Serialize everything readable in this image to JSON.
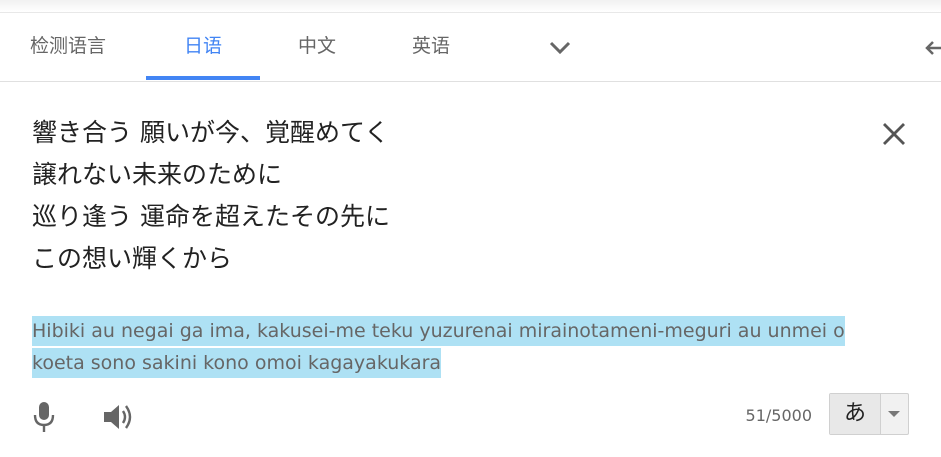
{
  "tabs": [
    {
      "label": "检测语言",
      "active": false
    },
    {
      "label": "日语",
      "active": true
    },
    {
      "label": "中文",
      "active": false
    },
    {
      "label": "英语",
      "active": false
    }
  ],
  "accent_color": "#4285f4",
  "source": {
    "lines": [
      "響き合う 願いが今、覚醒めてく",
      "譲れない未来のために",
      "巡り逢う 運命を超えたその先に",
      "この想い輝くから"
    ]
  },
  "transliteration": {
    "line1": "Hibiki au negai ga ima, kakusei-me teku yuzurenai mirainotameni-meguri au unmei o",
    "line2": "koeta sono sakini kono omoi kagayakukara",
    "highlight_color": "#aee1f4"
  },
  "footer": {
    "char_count": "51/5000",
    "ime_label": "あ",
    "icons": [
      "microphone-icon",
      "speaker-icon",
      "chevron-down-icon",
      "close-icon",
      "swap-icon"
    ]
  }
}
